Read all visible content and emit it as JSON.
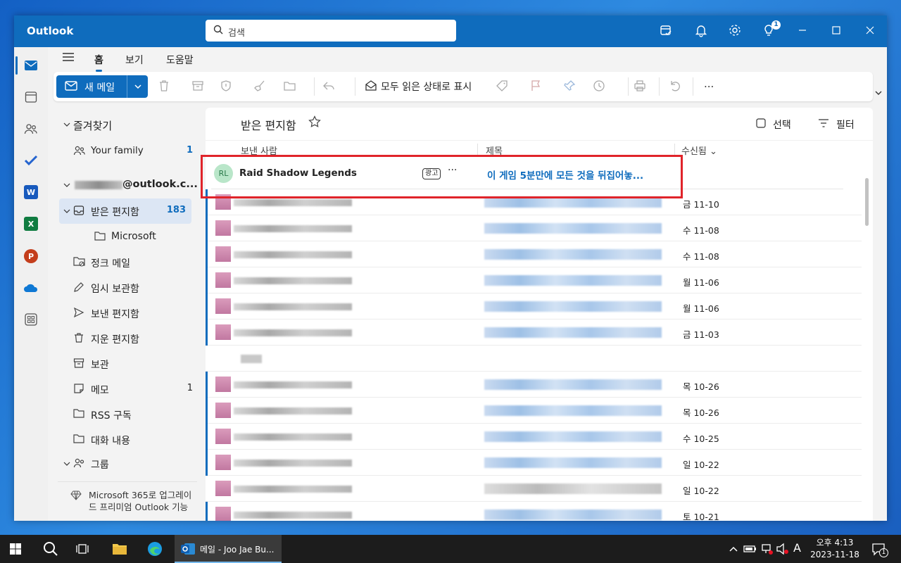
{
  "window": {
    "app_title": "Outlook",
    "search_placeholder": "검색",
    "tips_badge": "1"
  },
  "menu_tabs": [
    "홈",
    "보기",
    "도움말"
  ],
  "ribbon": {
    "new_mail": "새 메일",
    "mark_all_read": "모두 읽은 상태로 표시",
    "more": "..."
  },
  "folders": {
    "favorites_header": "즐겨찾기",
    "favorites": [
      {
        "label": "Your family",
        "count": "1"
      }
    ],
    "account": "@outlook.c...",
    "items": [
      {
        "label": "받은 편지함",
        "count": "183"
      },
      {
        "label": "Microsoft",
        "count": ""
      },
      {
        "label": "정크 메일",
        "count": ""
      },
      {
        "label": "임시 보관함",
        "count": ""
      },
      {
        "label": "보낸 편지함",
        "count": ""
      },
      {
        "label": "지운 편지함",
        "count": ""
      },
      {
        "label": "보관",
        "count": ""
      },
      {
        "label": "메모",
        "count": "1"
      },
      {
        "label": "RSS 구독",
        "count": ""
      },
      {
        "label": "대화 내용",
        "count": ""
      }
    ],
    "groups_header": "그룹",
    "upgrade": "Microsoft 365로 업그레이드 프리미엄 Outlook 기능"
  },
  "mail_list": {
    "title": "받은 편지함",
    "select": "선택",
    "filter": "필터",
    "col_from": "보낸 사람",
    "col_subject": "제목",
    "col_received": "수신됨",
    "ad": {
      "initials": "RL",
      "sender": "Raid Shadow Legends",
      "tag": "광고",
      "more": "···",
      "subject": "이 게임 5분만에 모든 것을 뒤집어놓..."
    },
    "dates": [
      "금 11-10",
      "수 11-08",
      "수 11-08",
      "월 11-06",
      "월 11-06",
      "금 11-03",
      "",
      "목 10-26",
      "목 10-26",
      "수 10-25",
      "일 10-22",
      "일 10-22",
      "토 10-21"
    ]
  },
  "taskbar": {
    "active_app": "메일 - Joo Jae Bu...",
    "ime": "A",
    "time": "오후 4:13",
    "date": "2023-11-18",
    "notif_count": "1"
  }
}
